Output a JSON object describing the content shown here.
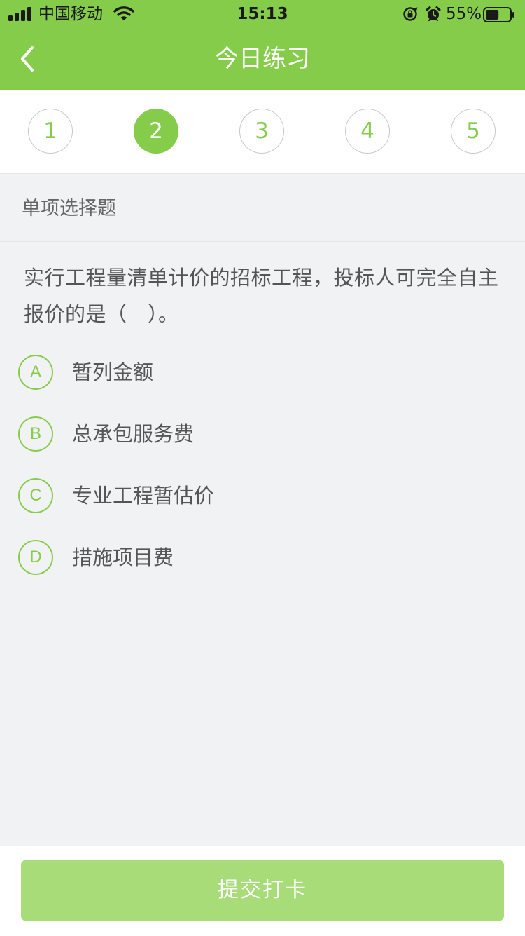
{
  "status_bar": {
    "carrier": "中国移动",
    "time": "15:13",
    "battery_percent": "55%",
    "battery_level": 0.55,
    "icons": [
      "signal-icon",
      "wifi-icon",
      "orientation-lock-icon",
      "alarm-icon",
      "battery-icon"
    ]
  },
  "nav": {
    "title": "今日练习",
    "back_icon": "chevron-left-icon"
  },
  "steps": [
    "1",
    "2",
    "3",
    "4",
    "5"
  ],
  "active_step": "2",
  "section": {
    "title": "单项选择题"
  },
  "question": {
    "text": "实行工程量清单计价的招标工程，投标人可完全自主报价的是（　）。",
    "options": [
      {
        "letter": "A",
        "text": "暂列金额"
      },
      {
        "letter": "B",
        "text": "总承包服务费"
      },
      {
        "letter": "C",
        "text": "专业工程暂估价"
      },
      {
        "letter": "D",
        "text": "措施项目费"
      }
    ]
  },
  "footer": {
    "submit_label": "提交打卡"
  },
  "colors": {
    "accent": "#85cc4b",
    "button": "#a7dc79",
    "background": "#f1f2f4"
  }
}
